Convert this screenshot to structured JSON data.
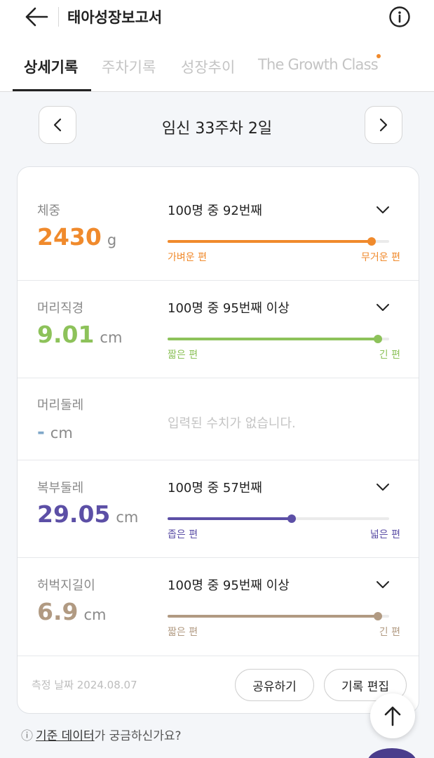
{
  "header": {
    "title": "태아성장보고서"
  },
  "tabs": [
    {
      "label": "상세기록",
      "active": true
    },
    {
      "label": "주차기록",
      "active": false
    },
    {
      "label": "성장추이",
      "active": false
    },
    {
      "label": "The Growth Class",
      "active": false,
      "has_new_dot": true
    }
  ],
  "week_nav": {
    "title": "임신 33주차 2일",
    "prev_icon": "chevron-left-icon",
    "next_icon": "chevron-right-icon"
  },
  "measurements": [
    {
      "label": "체중",
      "value": "2430",
      "unit": "g",
      "rank": "100명 중 92번째",
      "position": 0.92,
      "low": "가벼운 편",
      "high": "무거운 편",
      "color": "#f08a2c"
    },
    {
      "label": "머리직경",
      "value": "9.01",
      "unit": "cm",
      "rank": "100명 중 95번째 이상",
      "position": 0.95,
      "low": "짧은 편",
      "high": "긴 편",
      "color": "#8dc25a"
    },
    {
      "label": "머리둘레",
      "value": "-",
      "unit": "cm",
      "empty_message": "입력된 수치가 없습니다.",
      "color": "#7fa7c9"
    },
    {
      "label": "복부둘레",
      "value": "29.05",
      "unit": "cm",
      "rank": "100명 중 57번째",
      "position": 0.56,
      "low": "좁은 편",
      "high": "넓은 편",
      "color": "#5c4fa6"
    },
    {
      "label": "허벅지길이",
      "value": "6.9",
      "unit": "cm",
      "rank": "100명 중 95번째 이상",
      "position": 0.95,
      "low": "짧은 편",
      "high": "긴 편",
      "color": "#b19a82"
    }
  ],
  "footer": {
    "date_label": "측정 날짜 2024.08.07",
    "share_label": "공유하기",
    "edit_label": "기록 편집"
  },
  "help": {
    "prefix": "ⓘ",
    "link": "기준 데이터",
    "suffix": "가 궁금하신가요?"
  }
}
